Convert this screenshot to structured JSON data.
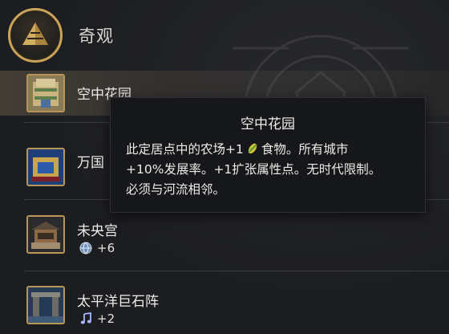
{
  "header": {
    "title": "奇观",
    "icon": "wonder-pyramid-icon",
    "accent": "#c9a45a"
  },
  "wonders": [
    {
      "name": "空中花园",
      "icon": "hanging-gardens-thumbnail",
      "stat": null,
      "selected": true
    },
    {
      "name": "万国",
      "icon": "wanguo-thumbnail",
      "stat": null,
      "selected": false
    },
    {
      "name": "未央宫",
      "icon": "weiyang-palace-thumbnail",
      "stat": {
        "icon": "globe-icon",
        "value": "+6"
      },
      "selected": false
    },
    {
      "name": "太平洋巨石阵",
      "icon": "pacific-megaliths-thumbnail",
      "stat": {
        "icon": "music-note-icon",
        "value": "+2"
      },
      "selected": false
    }
  ],
  "tooltip": {
    "title": "空中花园",
    "line1_before": "此定居点中的农场+1",
    "line1_icon": "food-icon",
    "line1_after": "食物。所有城市",
    "line2": "+10%发展率。+1扩张属性点。无时代限制。",
    "line3": "必须与河流相邻。"
  }
}
